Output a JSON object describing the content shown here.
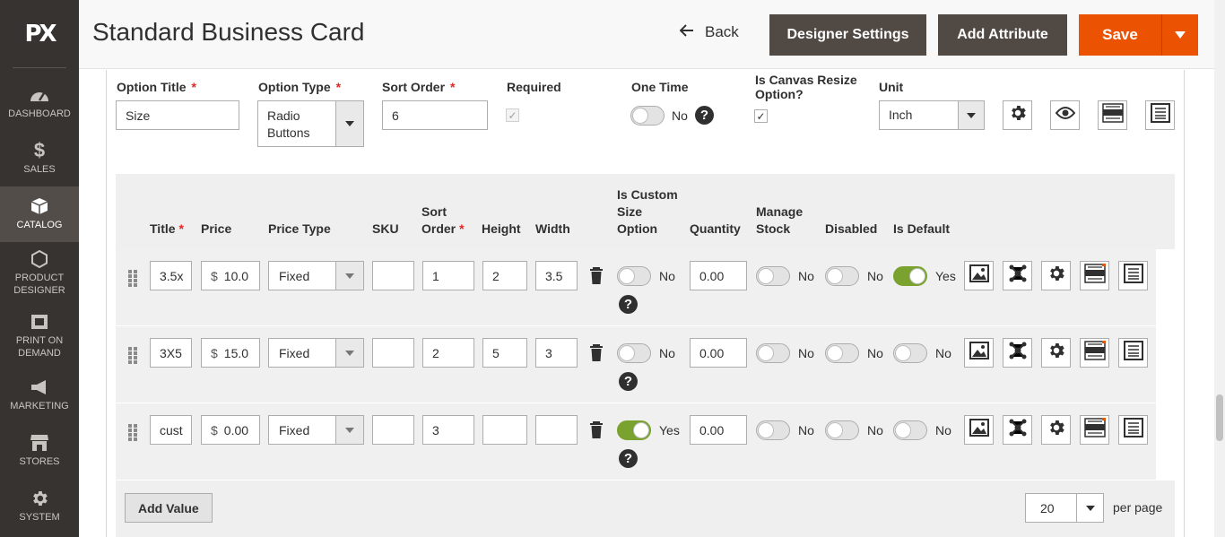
{
  "sidebar": {
    "logo": "PX",
    "items": [
      {
        "label": "DASHBOARD",
        "icon": "dashboard-icon"
      },
      {
        "label": "SALES",
        "icon": "dollar-icon"
      },
      {
        "label": "CATALOG",
        "icon": "box-icon",
        "active": true
      },
      {
        "label": "PRODUCT DESIGNER",
        "icon": "hexagon-icon"
      },
      {
        "label": "PRINT ON DEMAND",
        "icon": "printer-icon"
      },
      {
        "label": "MARKETING",
        "icon": "megaphone-icon"
      },
      {
        "label": "STORES",
        "icon": "store-icon"
      },
      {
        "label": "SYSTEM",
        "icon": "gear-icon"
      }
    ]
  },
  "header": {
    "title": "Standard Business Card",
    "back_label": "Back",
    "designer_settings_label": "Designer Settings",
    "add_attribute_label": "Add Attribute",
    "save_label": "Save"
  },
  "option": {
    "title_label": "Option Title",
    "title_value": "Size",
    "type_label": "Option Type",
    "type_value": "Radio Buttons",
    "sort_label": "Sort Order",
    "sort_value": "6",
    "required_label": "Required",
    "required_checked": true,
    "one_time_label": "One Time",
    "one_time_value": "No",
    "canvas_resize_label": "Is Canvas Resize Option?",
    "canvas_resize_checked": true,
    "unit_label": "Unit",
    "unit_value": "Inch",
    "asterisk": "*"
  },
  "grid": {
    "headers": {
      "title": "Title",
      "price": "Price",
      "price_type": "Price Type",
      "sku": "SKU",
      "sort_order": "Sort Order",
      "height": "Height",
      "width": "Width",
      "custom_size": "Is Custom Size Option",
      "quantity": "Quantity",
      "manage_stock": "Manage Stock",
      "disabled": "Disabled",
      "is_default": "Is Default"
    },
    "rows": [
      {
        "title": "3.5x",
        "currency": "$",
        "price": "10.0",
        "price_type": "Fixed",
        "sku": "",
        "sort": "1",
        "height": "2",
        "width": "3.5",
        "custom": "No",
        "custom_on": false,
        "qty": "0.00",
        "manage_stock": "No",
        "disabled": "No",
        "is_default": "Yes",
        "default_on": true
      },
      {
        "title": "3X5",
        "currency": "$",
        "price": "15.0",
        "price_type": "Fixed",
        "sku": "",
        "sort": "2",
        "height": "5",
        "width": "3",
        "custom": "No",
        "custom_on": false,
        "qty": "0.00",
        "manage_stock": "No",
        "disabled": "No",
        "is_default": "No",
        "default_on": false
      },
      {
        "title": "cust",
        "currency": "$",
        "price": "0.00",
        "price_type": "Fixed",
        "sku": "",
        "sort": "3",
        "height": "",
        "width": "",
        "custom": "Yes",
        "custom_on": true,
        "qty": "0.00",
        "manage_stock": "No",
        "disabled": "No",
        "is_default": "No",
        "default_on": false
      }
    ]
  },
  "footer": {
    "add_value_label": "Add Value",
    "per_page_value": "20",
    "per_page_label": "per page"
  },
  "colors": {
    "accent": "#eb5202",
    "sidebar": "#373330",
    "toggle_on": "#79a22e"
  }
}
